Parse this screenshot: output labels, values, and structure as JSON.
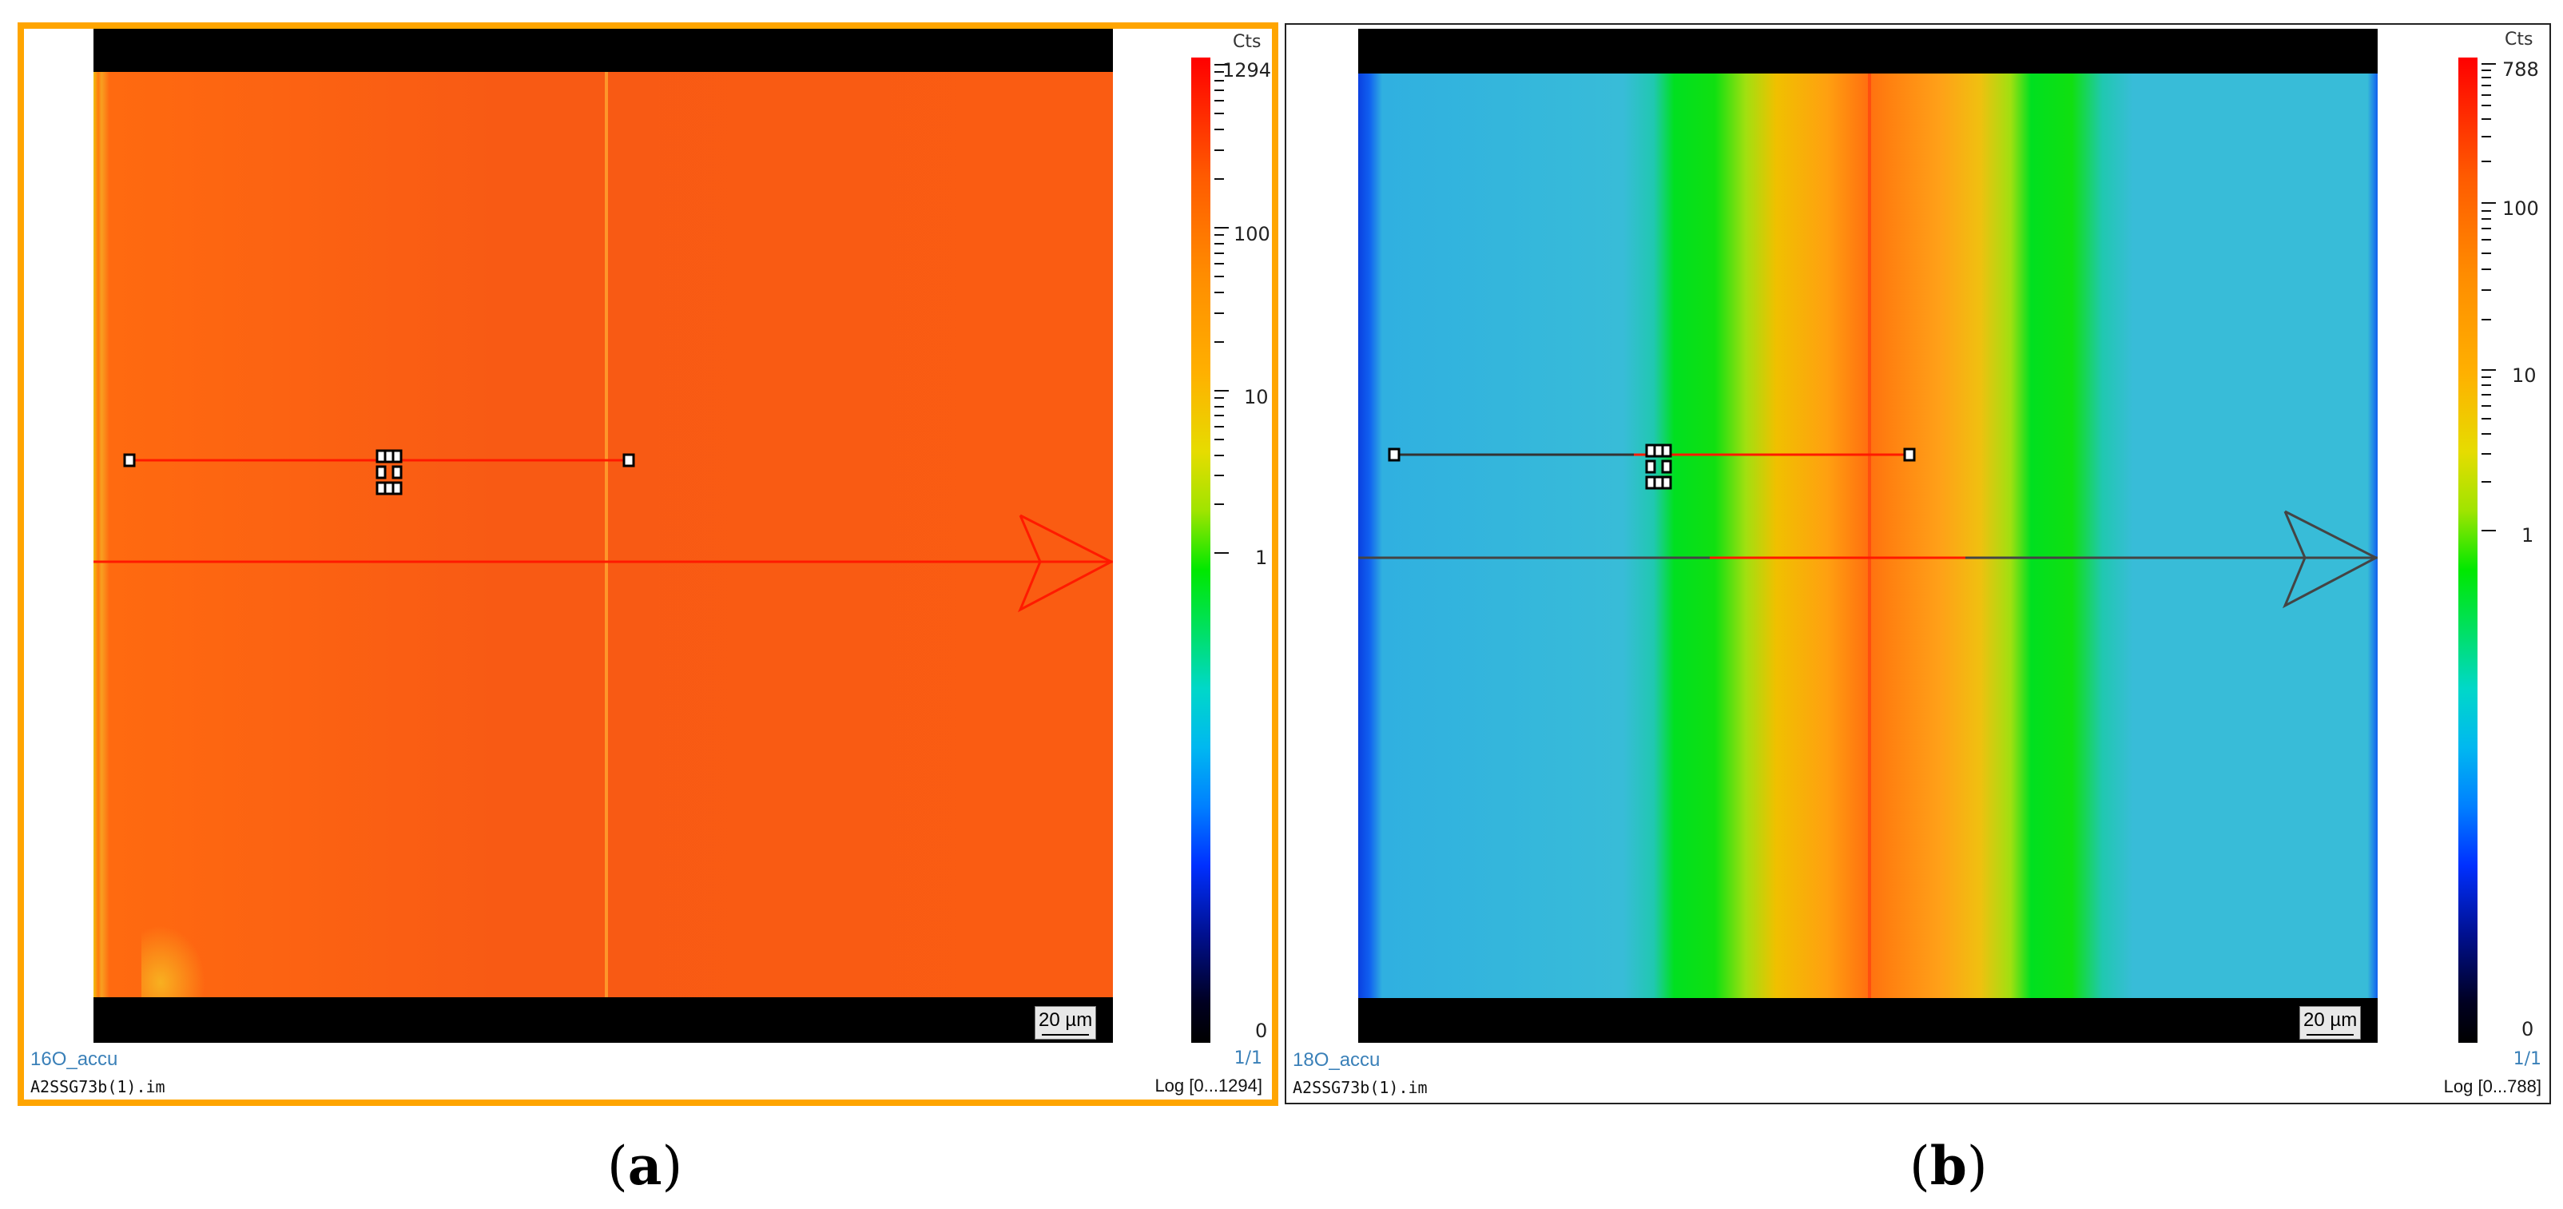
{
  "panels": [
    {
      "id": "a",
      "caption_open": "(",
      "caption_letter": "a",
      "caption_close": ")",
      "colorbar_unit": "Cts",
      "colorbar_labels": [
        "1294",
        "100",
        "10",
        "1",
        "0"
      ],
      "scale_bar": "20 µm",
      "image_name": "16O_accu",
      "file_name": "A2SSG73b(1).im",
      "page": "1/1",
      "range": "Log [0...1294]",
      "selected": true,
      "highlight_color": "#ffa500"
    },
    {
      "id": "b",
      "caption_open": "(",
      "caption_letter": "b",
      "caption_close": ")",
      "colorbar_unit": "Cts",
      "colorbar_labels": [
        "788",
        "100",
        "10",
        "1",
        "0"
      ],
      "scale_bar": "20 µm",
      "image_name": "18O_accu",
      "file_name": "A2SSG73b(1).im",
      "page": "1/1",
      "range": "Log [0...788]",
      "selected": false
    }
  ]
}
